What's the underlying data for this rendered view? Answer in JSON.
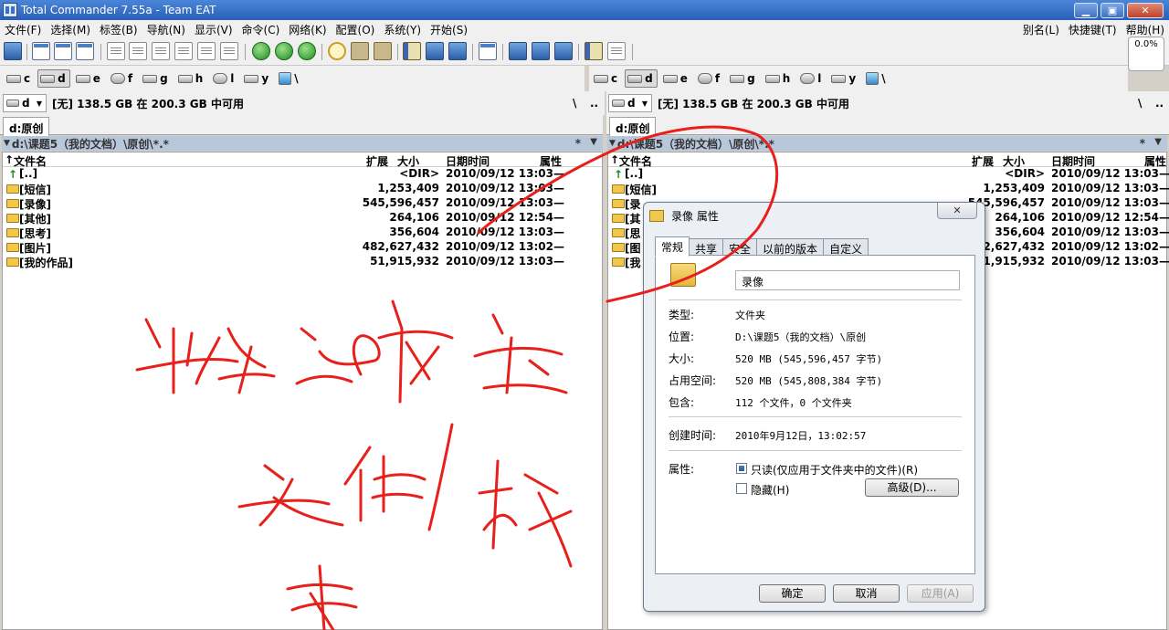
{
  "window": {
    "title": "Total Commander 7.55a - Team EAT"
  },
  "menu": {
    "items": [
      "文件(F)",
      "选择(M)",
      "标签(B)",
      "导航(N)",
      "显示(V)",
      "命令(C)",
      "网络(K)",
      "配置(O)",
      "系统(Y)",
      "开始(S)"
    ],
    "right": [
      "别名(L)",
      "快捷键(T)",
      "帮助(H)"
    ]
  },
  "progress": {
    "label": "0.0%",
    "value": 0.0
  },
  "drives": [
    "c",
    "d",
    "e",
    "f",
    "g",
    "h",
    "l",
    "y",
    "\\"
  ],
  "left": {
    "drive": "d",
    "space": "[无] 138.5 GB 在 200.3 GB 中可用",
    "backslash": "\\",
    "dots": "..",
    "tab": "d:原创",
    "path": "d:\\课题5（我的文档）\\原创\\*.*",
    "star": "*",
    "headers": {
      "name": "文件名",
      "ext": "扩展",
      "size": "大小",
      "date": "日期时间",
      "attr": "属性"
    },
    "rows": [
      {
        "name": "[..]",
        "size": "<DIR>",
        "date": "2010/09/12 13:03—"
      },
      {
        "name": "[短信]",
        "size": "1,253,409",
        "date": "2010/09/12 13:03—"
      },
      {
        "name": "[录像]",
        "size": "545,596,457",
        "date": "2010/09/12 13:03—"
      },
      {
        "name": "[其他]",
        "size": "264,106",
        "date": "2010/09/12 12:54—"
      },
      {
        "name": "[思考]",
        "size": "356,604",
        "date": "2010/09/12 13:03—"
      },
      {
        "name": "[图片]",
        "size": "482,627,432",
        "date": "2010/09/12 13:02—"
      },
      {
        "name": "[我的作品]",
        "size": "51,915,932",
        "date": "2010/09/12 13:03—"
      }
    ]
  },
  "right": {
    "drive": "d",
    "space": "[无] 138.5 GB 在 200.3 GB 中可用",
    "backslash": "\\",
    "dots": "..",
    "tab": "d:原创",
    "path": "d:\\课题5（我的文档）\\原创\\*.*",
    "star": "*",
    "headers": {
      "name": "文件名",
      "ext": "扩展",
      "size": "大小",
      "date": "日期时间",
      "attr": "属性"
    },
    "rows": [
      {
        "name": "[..]",
        "size": "<DIR>",
        "date": "2010/09/12 13:03—"
      },
      {
        "name": "[短信]",
        "size": "1,253,409",
        "date": "2010/09/12 13:03—"
      },
      {
        "name": "[录",
        "size": "545,596,457",
        "date": "2010/09/12 13:03—"
      },
      {
        "name": "[其",
        "size": "264,106",
        "date": "2010/09/12 12:54—"
      },
      {
        "name": "[思",
        "size": "356,604",
        "date": "2010/09/12 13:03—"
      },
      {
        "name": "[图",
        "size": "482,627,432",
        "date": "2010/09/12 13:02—"
      },
      {
        "name": "[我",
        "size": "51,915,932",
        "date": "2010/09/12 13:03—"
      }
    ]
  },
  "dialog": {
    "title": "录像 属性",
    "close": "✕",
    "tabs": [
      "常规",
      "共享",
      "安全",
      "以前的版本",
      "自定义"
    ],
    "name_value": "录像",
    "type_label": "类型:",
    "type_value": "文件夹",
    "location_label": "位置:",
    "location_value": "D:\\课题5（我的文档）\\原创",
    "size_label": "大小:",
    "size_value": "520 MB (545,596,457 字节)",
    "disk_label": "占用空间:",
    "disk_value": "520 MB (545,808,384 字节)",
    "contains_label": "包含:",
    "contains_value": "112 个文件，0 个文件夹",
    "created_label": "创建时间:",
    "created_value": "2010年9月12日，13:02:57",
    "attr_label": "属性:",
    "readonly_label": "只读(仅应用于文件夹中的文件)(R)",
    "readonly_checked": true,
    "hidden_label": "隐藏(H)",
    "hidden_checked": false,
    "advanced_button": "高级(D)...",
    "ok_button": "确定",
    "cancel_button": "取消",
    "apply_button": "应用(A)"
  },
  "colors": {
    "title_bar": "#2a5fb8",
    "path_bar": "#b8c8dc",
    "annotation": "#e8201c",
    "folder": "#f0c84e"
  }
}
